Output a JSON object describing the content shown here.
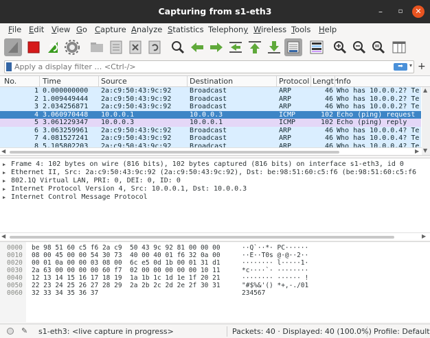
{
  "window": {
    "title": "Capturing from s1-eth3",
    "minimize": "–",
    "maximize": "▫",
    "close": "✕"
  },
  "menu": [
    {
      "label": "File",
      "u": "F",
      "rest": "ile"
    },
    {
      "label": "Edit",
      "u": "E",
      "rest": "dit"
    },
    {
      "label": "View",
      "u": "V",
      "rest": "iew"
    },
    {
      "label": "Go",
      "u": "G",
      "rest": "o"
    },
    {
      "label": "Capture",
      "u": "C",
      "rest": "apture"
    },
    {
      "label": "Analyze",
      "u": "A",
      "rest": "nalyze"
    },
    {
      "label": "Statistics",
      "u": "S",
      "rest": "tatistics"
    },
    {
      "label": "Telephony",
      "pre": "Telephon",
      "u": "y",
      "rest": ""
    },
    {
      "label": "Wireless",
      "u": "W",
      "rest": "ireless"
    },
    {
      "label": "Tools",
      "u": "T",
      "rest": "ools"
    },
    {
      "label": "Help",
      "u": "H",
      "rest": "elp"
    }
  ],
  "toolbar": {
    "icons": [
      "shark-fin-start-icon",
      "stop-capture-icon",
      "restart-capture-icon",
      "capture-options-icon",
      "open-file-icon",
      "save-file-icon",
      "close-file-icon",
      "reload-file-icon",
      "find-packet-icon",
      "go-back-icon",
      "go-forward-icon",
      "go-to-packet-icon",
      "go-first-icon",
      "go-last-icon",
      "autoscroll-icon",
      "colorize-icon",
      "zoom-in-icon",
      "zoom-out-icon",
      "zoom-normal-icon",
      "resize-columns-icon"
    ]
  },
  "filter": {
    "placeholder": "Apply a display filter … <Ctrl-/>",
    "value": "",
    "apply_label": "➡",
    "dropdown": "▾",
    "add": "+"
  },
  "packet_list": {
    "columns": [
      "No.",
      "Time",
      "Source",
      "Destination",
      "Protocol",
      "Length",
      "Info"
    ],
    "rows": [
      {
        "no": "1",
        "time": "0.000000000",
        "src": "2a:c9:50:43:9c:92",
        "dst": "Broadcast",
        "proto": "ARP",
        "len": "46",
        "info": "Who has 10.0.0.2? Te",
        "style": "arp"
      },
      {
        "no": "2",
        "time": "1.009449444",
        "src": "2a:c9:50:43:9c:92",
        "dst": "Broadcast",
        "proto": "ARP",
        "len": "46",
        "info": "Who has 10.0.0.2? Te",
        "style": "arp"
      },
      {
        "no": "3",
        "time": "2.034256871",
        "src": "2a:c9:50:43:9c:92",
        "dst": "Broadcast",
        "proto": "ARP",
        "len": "46",
        "info": "Who has 10.0.0.2? Te",
        "style": "arp"
      },
      {
        "no": "4",
        "time": "3.060970448",
        "src": "10.0.0.1",
        "dst": "10.0.0.3",
        "proto": "ICMP",
        "len": "102",
        "info": "Echo (ping) request",
        "style": "sel"
      },
      {
        "no": "5",
        "time": "3.061229347",
        "src": "10.0.0.3",
        "dst": "10.0.0.1",
        "proto": "ICMP",
        "len": "102",
        "info": "Echo (ping) reply",
        "style": "icmp2"
      },
      {
        "no": "6",
        "time": "3.063259961",
        "src": "2a:c9:50:43:9c:92",
        "dst": "Broadcast",
        "proto": "ARP",
        "len": "46",
        "info": "Who has 10.0.0.4? Te",
        "style": "arp"
      },
      {
        "no": "7",
        "time": "4.081527241",
        "src": "2a:c9:50:43:9c:92",
        "dst": "Broadcast",
        "proto": "ARP",
        "len": "46",
        "info": "Who has 10.0.0.4? Te",
        "style": "arp"
      },
      {
        "no": "8",
        "time": "5.105802203",
        "src": "2a:c9:50:43:9c:92",
        "dst": "Broadcast",
        "proto": "ARP",
        "len": "46",
        "info": "Who has 10.0.0.4? Te",
        "style": "arp"
      }
    ]
  },
  "details": [
    "Frame 4: 102 bytes on wire (816 bits), 102 bytes captured (816 bits) on interface s1-eth3, id 0",
    "Ethernet II, Src: 2a:c9:50:43:9c:92 (2a:c9:50:43:9c:92), Dst: be:98:51:60:c5:f6 (be:98:51:60:c5:f6",
    "802.1Q Virtual LAN, PRI: 0, DEI: 0, ID: 0",
    "Internet Protocol Version 4, Src: 10.0.0.1, Dst: 10.0.0.3",
    "Internet Control Message Protocol"
  ],
  "bytes": [
    {
      "off": "0000",
      "hex": "be 98 51 60 c5 f6 2a c9  50 43 9c 92 81 00 00 00",
      "asc": "··Q`··*· PC······"
    },
    {
      "off": "0010",
      "hex": "08 00 45 00 00 54 30 73  40 00 40 01 f6 32 0a 00",
      "asc": "··E··T0s @·@··2··"
    },
    {
      "off": "0020",
      "hex": "00 01 0a 00 00 03 08 00  6c e5 0d 1b 00 01 31 d1",
      "asc": "········ l·····1·"
    },
    {
      "off": "0030",
      "hex": "2a 63 00 00 00 00 60 f7  02 00 00 00 00 00 10 11",
      "asc": "*c····`· ········"
    },
    {
      "off": "0040",
      "hex": "12 13 14 15 16 17 18 19  1a 1b 1c 1d 1e 1f 20 21",
      "asc": "········ ······ !"
    },
    {
      "off": "0050",
      "hex": "22 23 24 25 26 27 28 29  2a 2b 2c 2d 2e 2f 30 31",
      "asc": "\"#$%&'() *+,-./01"
    },
    {
      "off": "0060",
      "hex": "32 33 34 35 36 37",
      "asc": "234567"
    }
  ],
  "status": {
    "interface": "s1-eth3: <live capture in progress>",
    "packets": "Packets: 40 · Displayed: 40 (100.0%)",
    "profile": "Profile: Default"
  }
}
